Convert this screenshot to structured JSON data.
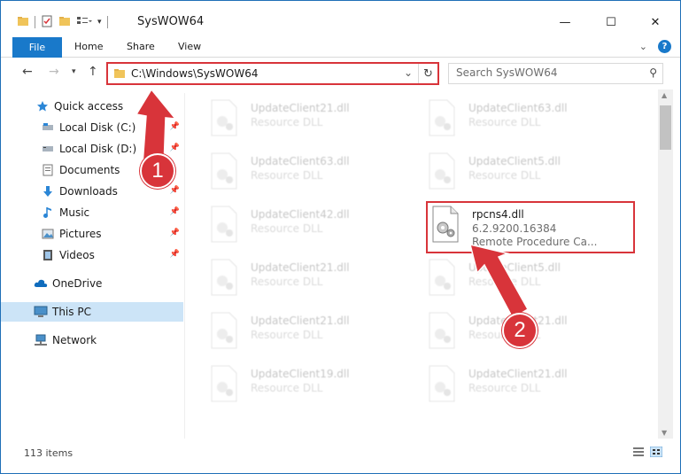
{
  "window": {
    "title": "SysWOW64"
  },
  "ribbon": {
    "tabs": [
      "File",
      "Home",
      "Share",
      "View"
    ]
  },
  "nav": {
    "address": "C:\\Windows\\SysWOW64",
    "search_placeholder": "Search SysWOW64"
  },
  "sidebar": {
    "items": [
      {
        "label": "Quick access"
      },
      {
        "label": "Local Disk (C:)"
      },
      {
        "label": "Local Disk (D:)"
      },
      {
        "label": "Documents"
      },
      {
        "label": "Downloads"
      },
      {
        "label": "Music"
      },
      {
        "label": "Pictures"
      },
      {
        "label": "Videos"
      },
      {
        "label": "OneDrive"
      },
      {
        "label": "This PC"
      },
      {
        "label": "Network"
      }
    ]
  },
  "files": {
    "left": [
      {
        "name": "UpdateClient21.dll",
        "type": "Resource DLL"
      },
      {
        "name": "UpdateClient63.dll",
        "type": "Resource DLL"
      },
      {
        "name": "UpdateClient42.dll",
        "type": "Resource DLL"
      },
      {
        "name": "UpdateClient21.dll",
        "type": "Resource DLL"
      },
      {
        "name": "UpdateClient21.dll",
        "type": "Resource DLL"
      },
      {
        "name": "UpdateClient19.dll",
        "type": "Resource DLL"
      }
    ],
    "right": [
      {
        "name": "UpdateClient63.dll",
        "type": "Resource DLL"
      },
      {
        "name": "UpdateClient5.dll",
        "type": "Resource DLL"
      },
      {
        "name": "UpdateClient5.dll",
        "type": "Resource DLL"
      },
      {
        "name": "UpdateClient21.dll",
        "type": "Resource DLL"
      },
      {
        "name": "UpdateClient21.dll",
        "type": "Resource DLL"
      }
    ],
    "target": {
      "name": "rpcns4.dll",
      "version": "6.2.9200.16384",
      "description": "Remote Procedure Ca..."
    }
  },
  "status": {
    "count": "113 items"
  },
  "annotations": {
    "step1": "1",
    "step2": "2"
  },
  "colors": {
    "accent": "#1979ca",
    "highlight": "#d8343a",
    "selected": "#cce4f7"
  }
}
